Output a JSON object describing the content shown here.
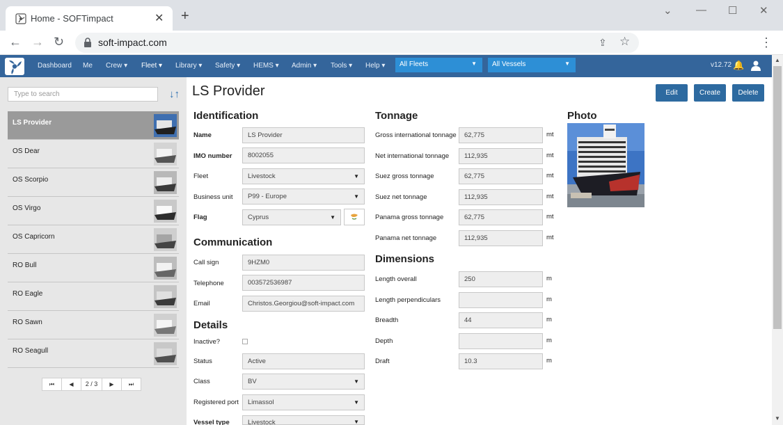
{
  "browser": {
    "tab_title": "Home - SOFTimpact",
    "tab_close": "✕",
    "new_tab": "+",
    "url": "soft-impact.com",
    "minimize": "—",
    "maximize": "☐",
    "close": "✕"
  },
  "nav": {
    "items": [
      "Dashboard",
      "Me",
      "Crew ▾",
      "Fleet ▾",
      "Library ▾",
      "Safety ▾",
      "HEMS ▾",
      "Admin ▾",
      "Tools ▾",
      "Help ▾"
    ],
    "fleet_filter": "All Fleets",
    "vessel_filter": "All Vessels",
    "version": "v12.72"
  },
  "sidebar": {
    "search_placeholder": "Type to search",
    "vessels": [
      "LS Provider",
      "OS Dear",
      "OS Scorpio",
      "OS Virgo",
      "OS Capricorn",
      "RO Bull",
      "RO Eagle",
      "RO Sawn",
      "RO Seagull"
    ],
    "selected_index": 0,
    "pager": {
      "first": "⏮",
      "prev": "◀",
      "info": "2 / 3",
      "next": "▶",
      "last": "⏭"
    }
  },
  "page": {
    "title": "LS Provider",
    "buttons": {
      "edit": "Edit",
      "create": "Create",
      "delete": "Delete"
    }
  },
  "identification": {
    "heading": "Identification",
    "name_label": "Name",
    "name": "LS Provider",
    "imo_label": "IMO number",
    "imo": "8002055",
    "fleet_label": "Fleet",
    "fleet": "Livestock",
    "bu_label": "Business unit",
    "bu": "P99 - Europe",
    "flag_label": "Flag",
    "flag": "Cyprus"
  },
  "communication": {
    "heading": "Communication",
    "call_sign_label": "Call sign",
    "call_sign": "9HZM0",
    "telephone_label": "Telephone",
    "telephone": "003572536987",
    "email_label": "Email",
    "email": "Christos.Georgiou@soft-impact.com"
  },
  "details": {
    "heading": "Details",
    "inactive_label": "Inactive?",
    "status_label": "Status",
    "status": "Active",
    "class_label": "Class",
    "class": "BV",
    "port_label": "Registered port",
    "port": "Limassol",
    "type_label": "Vessel type",
    "type": "Livestock"
  },
  "tonnage": {
    "heading": "Tonnage",
    "unit": "mt",
    "rows": [
      {
        "label": "Gross international tonnage",
        "value": "62,775"
      },
      {
        "label": "Net international tonnage",
        "value": "112,935"
      },
      {
        "label": "Suez gross tonnage",
        "value": "62,775"
      },
      {
        "label": "Suez net tonnage",
        "value": "112,935"
      },
      {
        "label": "Panama gross tonnage",
        "value": "62,775"
      },
      {
        "label": "Panama net tonnage",
        "value": "112,935"
      }
    ]
  },
  "dimensions": {
    "heading": "Dimensions",
    "unit": "m",
    "rows": [
      {
        "label": "Length overall",
        "value": "250"
      },
      {
        "label": "Length perpendiculars",
        "value": ""
      },
      {
        "label": "Breadth",
        "value": "44"
      },
      {
        "label": "Depth",
        "value": ""
      },
      {
        "label": "Draft",
        "value": "10.3"
      }
    ]
  },
  "photo": {
    "heading": "Photo"
  },
  "colors": {
    "navbar": "#34659b",
    "accent": "#2d8fd6",
    "button": "#2d6aa0",
    "selected_row": "#9a9a9a"
  }
}
